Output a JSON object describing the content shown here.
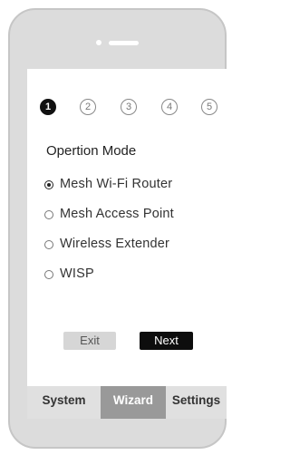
{
  "steps": [
    {
      "label": "1",
      "active": true
    },
    {
      "label": "2",
      "active": false
    },
    {
      "label": "3",
      "active": false
    },
    {
      "label": "4",
      "active": false
    },
    {
      "label": "5",
      "active": false
    }
  ],
  "page_title": "Opertion Mode",
  "options": [
    {
      "label": "Mesh Wi-Fi Router",
      "selected": true
    },
    {
      "label": "Mesh Access Point",
      "selected": false
    },
    {
      "label": "Wireless Extender",
      "selected": false
    },
    {
      "label": "WISP",
      "selected": false
    }
  ],
  "buttons": {
    "exit_label": "Exit",
    "next_label": "Next"
  },
  "tabs": [
    {
      "label": "System",
      "active": false
    },
    {
      "label": "Wizard",
      "active": true
    },
    {
      "label": "Settings",
      "active": false
    }
  ],
  "colors": {
    "phone_body": "#dcdcdc",
    "active_tab": "#999999",
    "next_button": "#0d0d0d"
  }
}
